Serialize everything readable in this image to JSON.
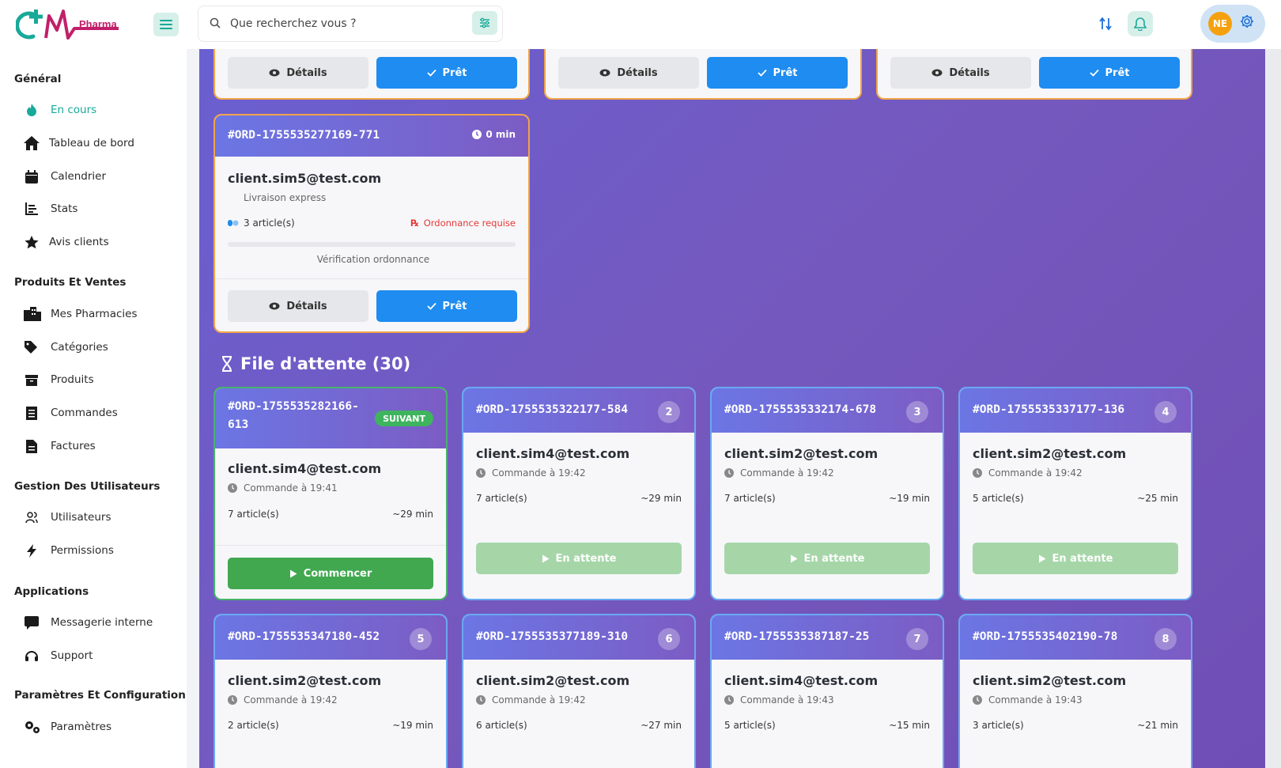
{
  "brand": {
    "logo_text": "Pharma",
    "colors": {
      "teal": "#18a999",
      "magenta": "#c21f6a",
      "purple_board": "#6a5fd0",
      "blue_btn": "#1e8cf0",
      "green_btn": "#41a850"
    }
  },
  "sidebar": {
    "sections": [
      {
        "title": "Général"
      },
      {
        "title": "Produits Et Ventes"
      },
      {
        "title": "Gestion Des Utilisateurs"
      },
      {
        "title": "Applications"
      },
      {
        "title": "Paramètres Et Configuration"
      }
    ],
    "items": [
      {
        "label": "En cours",
        "icon": "fire-icon"
      },
      {
        "label": "Tableau de bord",
        "icon": "home-icon"
      },
      {
        "label": "Calendrier",
        "icon": "calendar-icon"
      },
      {
        "label": "Stats",
        "icon": "bar-chart-icon"
      },
      {
        "label": "Avis clients",
        "icon": "star-icon"
      },
      {
        "label": "Mes Pharmacies",
        "icon": "building-icon"
      },
      {
        "label": "Catégories",
        "icon": "tags-icon"
      },
      {
        "label": "Produits",
        "icon": "box-icon"
      },
      {
        "label": "Commandes",
        "icon": "receipt-icon"
      },
      {
        "label": "Factures",
        "icon": "invoice-icon"
      },
      {
        "label": "Utilisateurs",
        "icon": "users-icon"
      },
      {
        "label": "Permissions",
        "icon": "bolt-icon"
      },
      {
        "label": "Messagerie interne",
        "icon": "chat-icon"
      },
      {
        "label": "Support",
        "icon": "headset-icon"
      },
      {
        "label": "Paramètres",
        "icon": "gears-icon"
      }
    ]
  },
  "topbar": {
    "search_placeholder": "Que recherchez vous ?",
    "avatar_initials": "NE"
  },
  "in_progress": {
    "top_row_buttons": {
      "details": "Détails",
      "ready": "Prêt"
    },
    "card": {
      "order_id": "#ORD-1755535277169-771",
      "timer": "0 min",
      "email": "client.sim5@test.com",
      "delivery": "Livraison express",
      "articles": "3 article(s)",
      "prescription": "Ordonnance requise",
      "status": "Vérification ordonnance",
      "details": "Détails",
      "ready": "Prêt"
    }
  },
  "queue": {
    "title": "File d'attente (30)",
    "next_badge": "SUIVANT",
    "cards": [
      {
        "order_id_1": "#ORD-1755535282166-",
        "order_id_2": "613",
        "email": "client.sim4@test.com",
        "time": "Commande à 19:41",
        "articles": "7 article(s)",
        "eta": "~29 min",
        "action": "Commencer"
      },
      {
        "order_id": "#ORD-1755535322177-584",
        "num": "2",
        "email": "client.sim4@test.com",
        "time": "Commande à 19:42",
        "articles": "7 article(s)",
        "eta": "~29 min",
        "action": "En attente"
      },
      {
        "order_id": "#ORD-1755535332174-678",
        "num": "3",
        "email": "client.sim2@test.com",
        "time": "Commande à 19:42",
        "articles": "7 article(s)",
        "eta": "~19 min",
        "action": "En attente"
      },
      {
        "order_id": "#ORD-1755535337177-136",
        "num": "4",
        "email": "client.sim2@test.com",
        "time": "Commande à 19:42",
        "articles": "5 article(s)",
        "eta": "~25 min",
        "action": "En attente"
      },
      {
        "order_id": "#ORD-1755535347180-452",
        "num": "5",
        "email": "client.sim2@test.com",
        "time": "Commande à 19:42",
        "articles": "2 article(s)",
        "eta": "~19 min"
      },
      {
        "order_id": "#ORD-1755535377189-310",
        "num": "6",
        "email": "client.sim2@test.com",
        "time": "Commande à 19:42",
        "articles": "6 article(s)",
        "eta": "~27 min"
      },
      {
        "order_id": "#ORD-1755535387187-25",
        "num": "7",
        "email": "client.sim4@test.com",
        "time": "Commande à 19:43",
        "articles": "5 article(s)",
        "eta": "~15 min"
      },
      {
        "order_id": "#ORD-1755535402190-78",
        "num": "8",
        "email": "client.sim2@test.com",
        "time": "Commande à 19:43",
        "articles": "3 article(s)",
        "eta": "~21 min"
      }
    ]
  }
}
